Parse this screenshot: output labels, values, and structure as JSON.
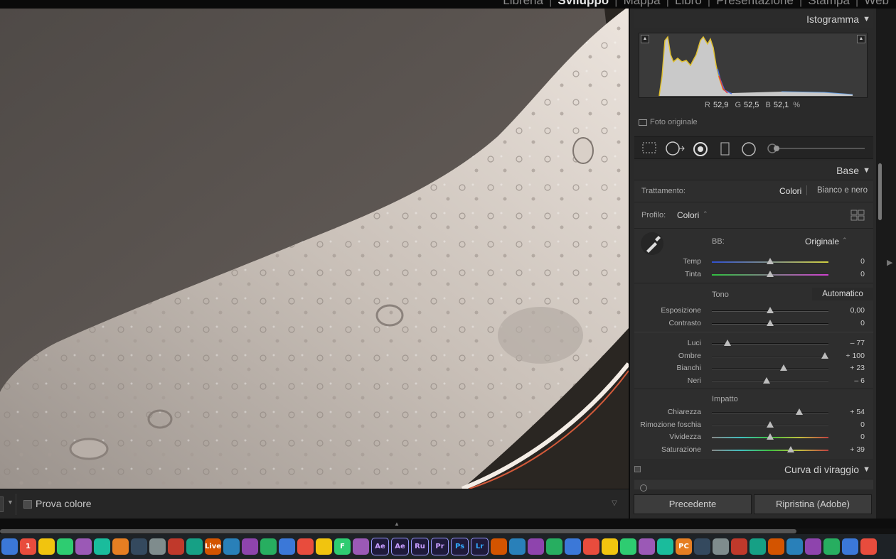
{
  "modules": [
    "Libreria",
    "|",
    "Sviluppo",
    "|",
    "Mappa",
    "|",
    "Libro",
    "|",
    "Presentazione",
    "|",
    "Stampa",
    "|",
    "Web"
  ],
  "active_module": "Sviluppo",
  "histogram": {
    "title": "Istogramma",
    "r_label": "R",
    "r_value": "52,9",
    "g_label": "G",
    "g_value": "52,5",
    "b_label": "B",
    "b_value": "52,1",
    "percent": "%",
    "original_photo": "Foto originale"
  },
  "base": {
    "title": "Base",
    "treatment_label": "Trattamento:",
    "treatment_color": "Colori",
    "treatment_bw": "Bianco e nero",
    "profile_label": "Profilo:",
    "profile_value": "Colori",
    "wb_label": "BB:",
    "wb_value": "Originale",
    "tone_label": "Tono",
    "auto_label": "Automatico",
    "presence_label": "Impatto",
    "sliders": {
      "temp": {
        "label": "Temp",
        "value": "0",
        "pos": 0.5
      },
      "tint": {
        "label": "Tinta",
        "value": "0",
        "pos": 0.5
      },
      "exposure": {
        "label": "Esposizione",
        "value": "0,00",
        "pos": 0.5
      },
      "contrast": {
        "label": "Contrasto",
        "value": "0",
        "pos": 0.5
      },
      "highlights": {
        "label": "Luci",
        "value": "– 77",
        "pos": 0.135
      },
      "shadows": {
        "label": "Ombre",
        "value": "+ 100",
        "pos": 0.97
      },
      "whites": {
        "label": "Bianchi",
        "value": "+ 23",
        "pos": 0.615
      },
      "blacks": {
        "label": "Neri",
        "value": "– 6",
        "pos": 0.47
      },
      "clarity": {
        "label": "Chiarezza",
        "value": "+ 54",
        "pos": 0.75
      },
      "dehaze": {
        "label": "Rimozione foschia",
        "value": "0",
        "pos": 0.5
      },
      "vibrance": {
        "label": "Vividezza",
        "value": "0",
        "pos": 0.5
      },
      "saturation": {
        "label": "Saturazione",
        "value": "+ 39",
        "pos": 0.675
      }
    }
  },
  "tone_curve": {
    "title": "Curva di viraggio"
  },
  "buttons": {
    "previous": "Precedente",
    "reset": "Ripristina (Adobe)"
  },
  "toolbar": {
    "soft_proof": "Prova colore"
  },
  "dock_icons": [
    "finder",
    "calendar",
    "notes",
    "preview",
    "photos",
    "safari",
    "facetime",
    "music",
    "appstore",
    "docs",
    "toolbox",
    "live",
    "stocks",
    "vlc",
    "teamviewer",
    "minecraft",
    "unity",
    "blender",
    "fusion",
    "imovie",
    "ae",
    "ae",
    "ru",
    "pr",
    "ps",
    "lr",
    "gpu",
    "telescope",
    "inkscape",
    "ruby",
    "stellarium",
    "eye",
    "messenger",
    "arduino",
    "arduino",
    "evernote",
    "pycharm",
    "terminal",
    "activity",
    "quicktime",
    "preferences",
    "archive",
    "screen",
    "display",
    "paint",
    "photo",
    "trash"
  ]
}
